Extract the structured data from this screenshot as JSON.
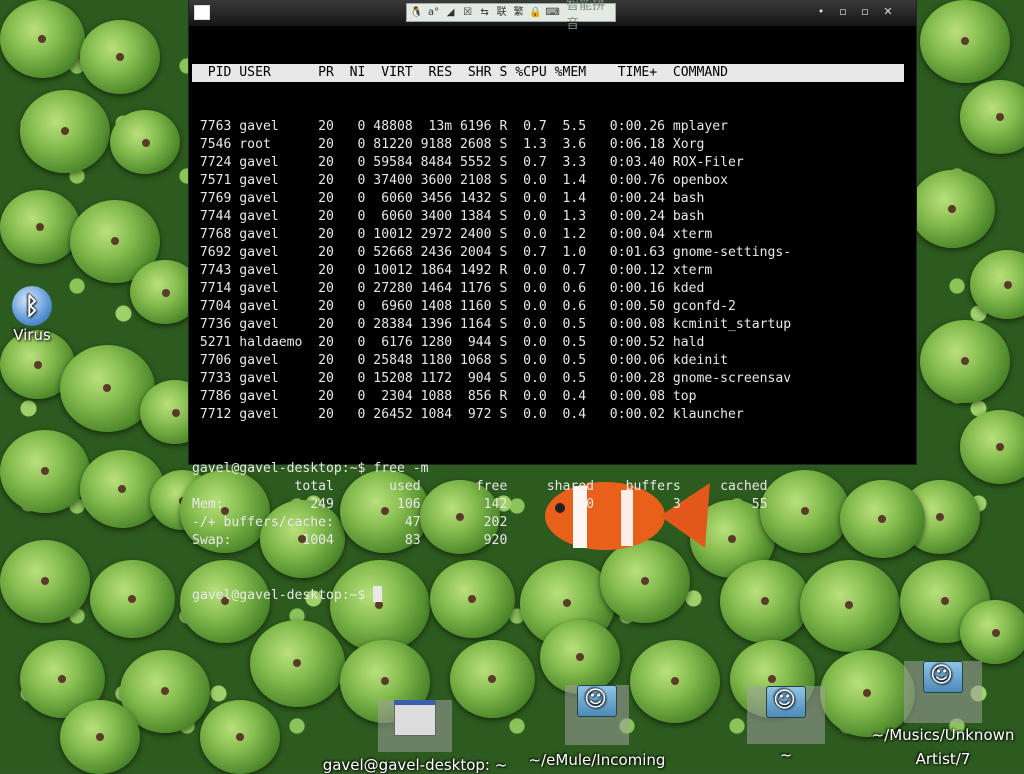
{
  "ime": {
    "label": "智能拼音",
    "buttons": [
      "🐧",
      "a°",
      "◢",
      "☒",
      "⇆",
      "联",
      "繁",
      "🔒",
      "⌨"
    ]
  },
  "window_buttons": [
    "•",
    "▫",
    "▫",
    "✕"
  ],
  "top_header": "  PID USER      PR  NI  VIRT  RES  SHR S %CPU %MEM    TIME+  COMMAND          ",
  "top_rows": [
    " 7763 gavel     20   0 48808  13m 6196 R  0.7  5.5   0:00.26 mplayer",
    " 7546 root      20   0 81220 9188 2608 S  1.3  3.6   0:06.18 Xorg",
    " 7724 gavel     20   0 59584 8484 5552 S  0.7  3.3   0:03.40 ROX-Filer",
    " 7571 gavel     20   0 37400 3600 2108 S  0.0  1.4   0:00.76 openbox",
    " 7769 gavel     20   0  6060 3456 1432 S  0.0  1.4   0:00.24 bash",
    " 7744 gavel     20   0  6060 3400 1384 S  0.0  1.3   0:00.24 bash",
    " 7768 gavel     20   0 10012 2972 2400 S  0.0  1.2   0:00.04 xterm",
    " 7692 gavel     20   0 52668 2436 2004 S  0.7  1.0   0:01.63 gnome-settings-",
    " 7743 gavel     20   0 10012 1864 1492 R  0.0  0.7   0:00.12 xterm",
    " 7714 gavel     20   0 27280 1464 1176 S  0.0  0.6   0:00.16 kded",
    " 7704 gavel     20   0  6960 1408 1160 S  0.0  0.6   0:00.50 gconfd-2",
    " 7736 gavel     20   0 28384 1396 1164 S  0.0  0.5   0:00.08 kcminit_startup",
    " 5271 haldaemo  20   0  6176 1280  944 S  0.0  0.5   0:00.52 hald",
    " 7706 gavel     20   0 25848 1180 1068 S  0.0  0.5   0:00.06 kdeinit",
    " 7733 gavel     20   0 15208 1172  904 S  0.0  0.5   0:00.28 gnome-screensav",
    " 7786 gavel     20   0  2304 1088  856 R  0.0  0.4   0:00.08 top",
    " 7712 gavel     20   0 26452 1084  972 S  0.0  0.4   0:00.02 klauncher"
  ],
  "free_lines": [
    "gavel@gavel-desktop:~$ free -m",
    "             total       used       free     shared    buffers     cached",
    "Mem:           249        106        142          0          3         55",
    "-/+ buffers/cache:         47        202",
    "Swap:         1004         83        920"
  ],
  "prompt": "gavel@gavel-desktop:~$ ",
  "desktop_icon": {
    "label": "Virus",
    "glyph": "ᛒ"
  },
  "taskbar": [
    {
      "label": "gavel@gavel-desktop: ~",
      "icon": "window-thumbnail-icon"
    },
    {
      "label": "~/eMule/Incoming",
      "icon": "folder-icon"
    },
    {
      "label": "~",
      "icon": "folder-icon"
    },
    {
      "label": "~/Musics/Unknown Artist/7",
      "line1": "~/Musics/Unknown",
      "line2": "Artist/7",
      "icon": "folder-icon"
    }
  ]
}
